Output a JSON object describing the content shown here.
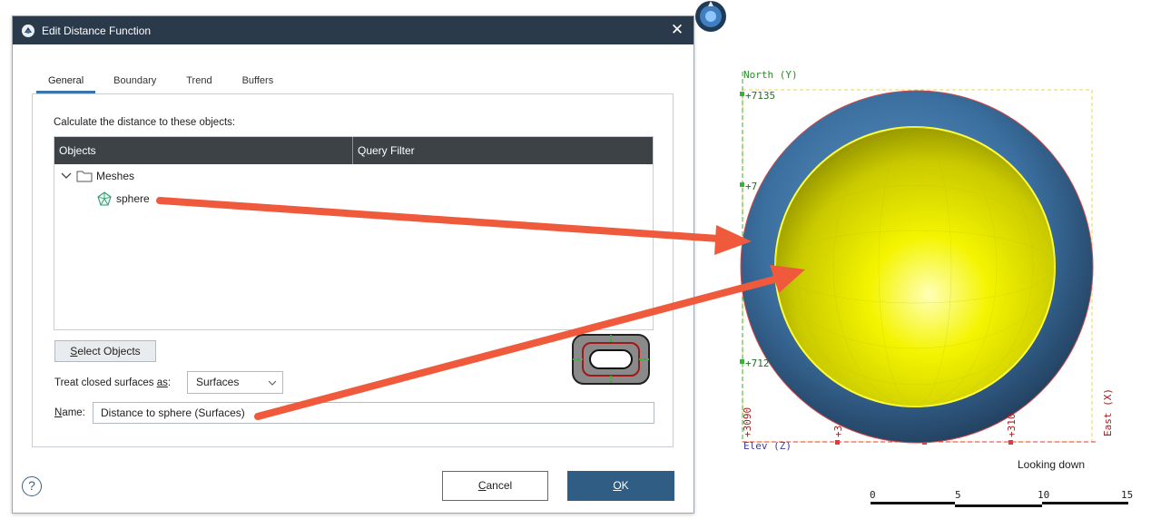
{
  "dialog": {
    "title": "Edit Distance Function",
    "close_symbol": "✕",
    "tabs": [
      {
        "label": "General",
        "active": true
      },
      {
        "label": "Boundary",
        "active": false
      },
      {
        "label": "Trend",
        "active": false
      },
      {
        "label": "Buffers",
        "active": false
      }
    ],
    "calc_label": "Calculate the distance to these objects:",
    "table": {
      "columns": [
        "Objects",
        "Query Filter"
      ],
      "rows": [
        {
          "label": "Meshes",
          "icon": "folder-icon",
          "expanded": true
        },
        {
          "label": "sphere",
          "icon": "mesh-icon"
        }
      ]
    },
    "select_objects": {
      "mnemonic": "S",
      "rest": "elect Objects"
    },
    "treat_label": {
      "before": "Treat closed surfaces ",
      "mnemonic": "as",
      "after": ":"
    },
    "treat_value": "Surfaces",
    "name_label": {
      "mnemonic": "N",
      "rest": "ame:"
    },
    "name_value": "Distance to sphere (Surfaces)",
    "help_symbol": "?",
    "cancel": {
      "mnemonic": "C",
      "rest": "ancel"
    },
    "ok": {
      "mnemonic": "O",
      "rest": "K"
    }
  },
  "viewer": {
    "north_label": "North (Y)",
    "north_ticks": [
      "+7135",
      "+7",
      "+712"
    ],
    "east_label": "East (X)",
    "east_ticks": [
      "+3090",
      "+3",
      "+310"
    ],
    "elev_label": "Elev (Z)",
    "looking_label": "Looking down",
    "scale_ticks": [
      "0",
      "5",
      "10",
      "15"
    ]
  },
  "colors": {
    "titlebar": "#2b3a4a",
    "accent": "#3a73a8",
    "ok_button": "#2f5d84",
    "arrow": "#f05a3c",
    "sphere_outer": "#3b6f9f",
    "sphere_inner": "#f2f200",
    "axis_green": "#2db82d",
    "axis_red": "#e23b3b"
  }
}
